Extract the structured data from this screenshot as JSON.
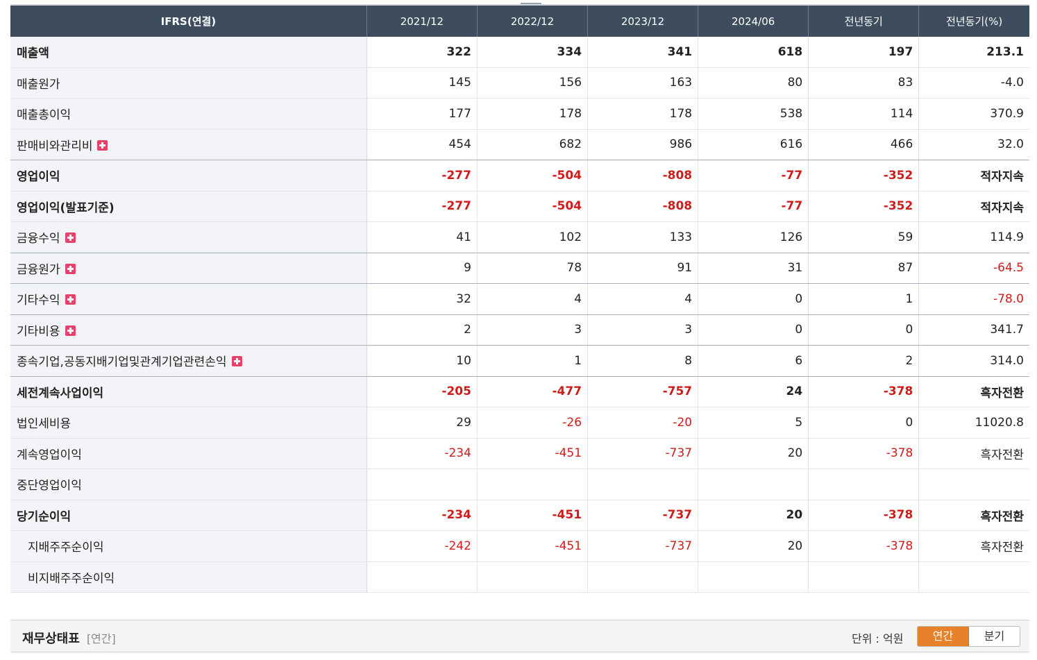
{
  "table": {
    "headers": [
      "IFRS(연결)",
      "2021/12",
      "2022/12",
      "2023/12",
      "2024/06",
      "전년동기",
      "전년동기(%)"
    ],
    "rows": [
      {
        "label": "매출액",
        "values": [
          "322",
          "334",
          "341",
          "618",
          "197",
          "213.1"
        ]
      },
      {
        "label": "매출원가",
        "values": [
          "145",
          "156",
          "163",
          "80",
          "83",
          "-4.0"
        ]
      },
      {
        "label": "매출총이익",
        "values": [
          "177",
          "178",
          "178",
          "538",
          "114",
          "370.9"
        ]
      },
      {
        "label": "판매비와관리비",
        "values": [
          "454",
          "682",
          "986",
          "616",
          "466",
          "32.0"
        ]
      },
      {
        "label": "영업이익",
        "values": [
          "-277",
          "-504",
          "-808",
          "-77",
          "-352",
          "적자지속"
        ]
      },
      {
        "label": "영업이익(발표기준)",
        "values": [
          "-277",
          "-504",
          "-808",
          "-77",
          "-352",
          "적자지속"
        ]
      },
      {
        "label": "금융수익",
        "values": [
          "41",
          "102",
          "133",
          "126",
          "59",
          "114.9"
        ]
      },
      {
        "label": "금융원가",
        "values": [
          "9",
          "78",
          "91",
          "31",
          "87",
          "-64.5"
        ]
      },
      {
        "label": "기타수익",
        "values": [
          "32",
          "4",
          "4",
          "0",
          "1",
          "-78.0"
        ]
      },
      {
        "label": "기타비용",
        "values": [
          "2",
          "3",
          "3",
          "0",
          "0",
          "341.7"
        ]
      },
      {
        "label": "종속기업,공동지배기업및관계기업관련손익",
        "values": [
          "10",
          "1",
          "8",
          "6",
          "2",
          "314.0"
        ]
      },
      {
        "label": "세전계속사업이익",
        "values": [
          "-205",
          "-477",
          "-757",
          "24",
          "-378",
          "흑자전환"
        ]
      },
      {
        "label": "법인세비용",
        "values": [
          "29",
          "-26",
          "-20",
          "5",
          "0",
          "11020.8"
        ]
      },
      {
        "label": "계속영업이익",
        "values": [
          "-234",
          "-451",
          "-737",
          "20",
          "-378",
          "흑자전환"
        ]
      },
      {
        "label": "중단영업이익",
        "values": [
          "",
          "",
          "",
          "",
          "",
          ""
        ]
      },
      {
        "label": "당기순이익",
        "values": [
          "-234",
          "-451",
          "-737",
          "20",
          "-378",
          "흑자전환"
        ]
      },
      {
        "label": "지배주주순이익",
        "values": [
          "-242",
          "-451",
          "-737",
          "20",
          "-378",
          "흑자전환"
        ]
      },
      {
        "label": "비지배주주순이익",
        "values": [
          "",
          "",
          "",
          "",
          "",
          ""
        ]
      }
    ]
  },
  "section": {
    "title": "재무상태표",
    "period": "[연간]",
    "unit": "단위 : 억원",
    "toggle": [
      "연간",
      "분기"
    ]
  },
  "colors": {
    "header_bg": "#3d4d5e",
    "negative": "#d11a1a",
    "active_toggle": "#e8822a",
    "expand_icon": "#e8416a"
  }
}
